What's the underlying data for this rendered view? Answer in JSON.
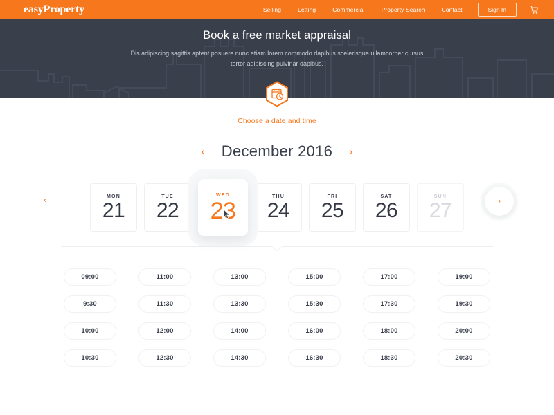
{
  "colors": {
    "brand_orange": "#F7771D",
    "hero_dark": "#3A3F4C",
    "text_dark": "#333844",
    "muted": "#C9CCD3",
    "disabled": "#D7D9DE",
    "border": "#EFEFF1"
  },
  "header": {
    "logo": "easyProperty",
    "nav_items": [
      {
        "label": "Selling"
      },
      {
        "label": "Letting"
      },
      {
        "label": "Commercial"
      },
      {
        "label": "Property Search"
      },
      {
        "label": "Contact"
      }
    ],
    "signin_label": "Sign In",
    "cart_icon": "shopping-cart-icon"
  },
  "hero": {
    "title": "Book a free market appraisal",
    "subtitle": "Dis adipiscing sagittis aptent posuere nunc etiam lorem commodo dapibus scelerisque ullamcorper cursus tortor adipiscing pulvinar dapibus.",
    "badge_icon": "calendar-clock-icon",
    "badge_shape": "hexagon"
  },
  "booking": {
    "section_label": "Choose a date and time",
    "month_prev_icon": "chevron-left-icon",
    "month_next_icon": "chevron-right-icon",
    "month_title": "December 2016",
    "days_prev_icon": "chevron-left-icon",
    "days_next_icon": "chevron-right-icon",
    "days": [
      {
        "name": "MON",
        "number": "21",
        "state": "available"
      },
      {
        "name": "TUE",
        "number": "22",
        "state": "available"
      },
      {
        "name": "WED",
        "number": "23",
        "state": "selected"
      },
      {
        "name": "THU",
        "number": "24",
        "state": "available"
      },
      {
        "name": "FRI",
        "number": "25",
        "state": "available"
      },
      {
        "name": "SAT",
        "number": "26",
        "state": "available"
      },
      {
        "name": "SUN",
        "number": "27",
        "state": "disabled"
      }
    ],
    "time_slots": [
      "09:00",
      "11:00",
      "13:00",
      "15:00",
      "17:00",
      "19:00",
      "9:30",
      "11:30",
      "13:30",
      "15:30",
      "17:30",
      "19:30",
      "10:00",
      "12:00",
      "14:00",
      "16:00",
      "18:00",
      "20:00",
      "10:30",
      "12:30",
      "14:30",
      "16:30",
      "18:30",
      "20:30"
    ]
  },
  "cursor": {
    "icon": "mouse-pointer-icon",
    "over": "day-card-23"
  }
}
